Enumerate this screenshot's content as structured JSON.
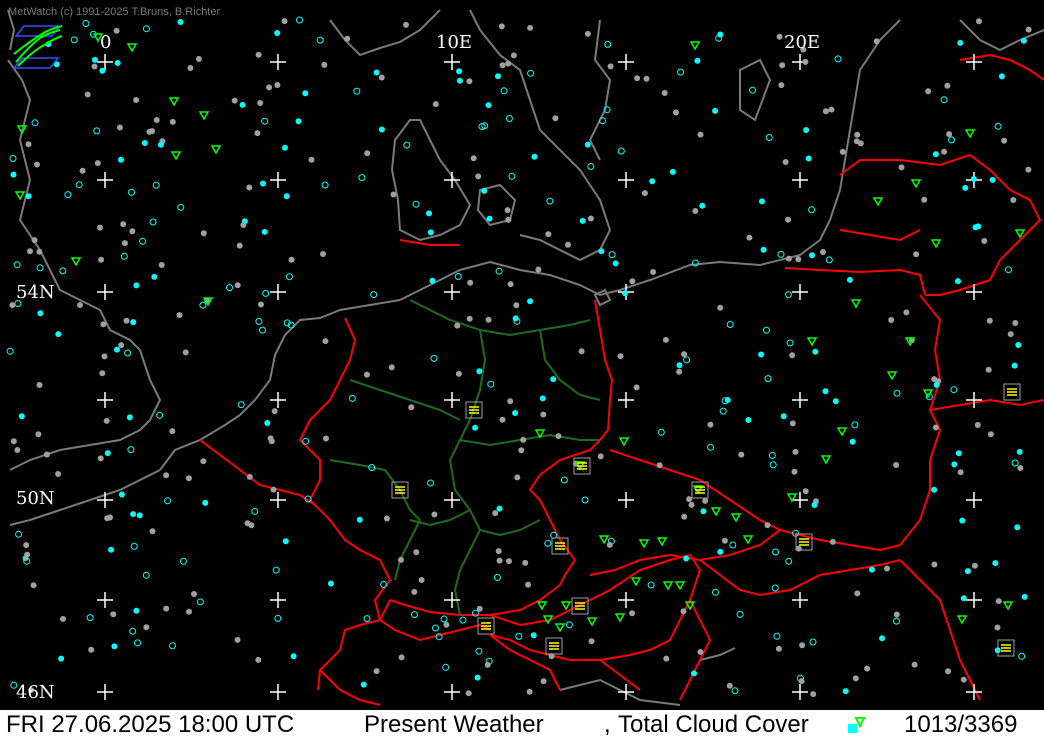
{
  "app": {
    "credit": "MetWatch  (c) 1991-2025 T.Bruns, B.Richter"
  },
  "map": {
    "longitude_labels": [
      "0",
      "10E",
      "20E"
    ],
    "latitude_labels": [
      "54N",
      "50N",
      "46N"
    ],
    "colors": {
      "background": "#000000",
      "coastline": "#7a7a7a",
      "country_border": "#ff0000",
      "state_border": "#1f6b1f",
      "grid": "#ffffff",
      "cloud_symbol": "#00ffff",
      "station_gray": "#a0a0a0",
      "weather_symbol": "#00ff00",
      "highlight_symbol": "#ffff00"
    },
    "icons": [
      "station-circle-icon",
      "precipitation-symbol-icon",
      "fog-symbol-icon",
      "thunderstorm-symbol-icon"
    ]
  },
  "statusbar": {
    "datetime": "FRI 27.06.2025 18:00 UTC",
    "parameter": "Present Weather",
    "separator": ",",
    "parameter2": "Total Cloud Cover",
    "count": "1013/3369"
  }
}
